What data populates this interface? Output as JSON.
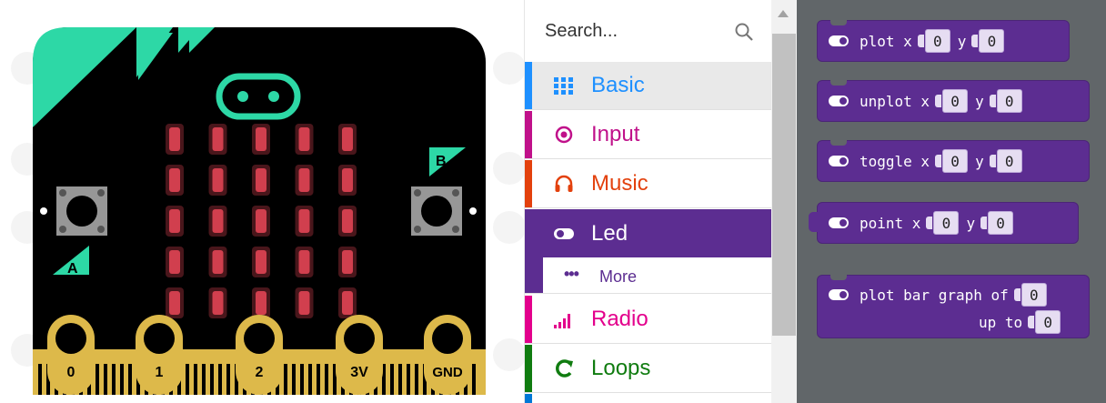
{
  "simulator": {
    "led_rows": 5,
    "led_cols": 5,
    "led_color": "#d13f4e",
    "board_color": "#000000",
    "accent_color": "#2dd8a6",
    "pin_color": "#ddb94a",
    "button_a_label": "A",
    "button_b_label": "B",
    "pins": [
      "0",
      "1",
      "2",
      "3V",
      "GND"
    ]
  },
  "toolbox": {
    "search_placeholder": "Search...",
    "categories": [
      {
        "label": "Basic",
        "color": "#1e90ff",
        "icon": "grid-icon"
      },
      {
        "label": "Input",
        "color": "#c0118a",
        "icon": "target-icon"
      },
      {
        "label": "Music",
        "color": "#e3410d",
        "icon": "headphones-icon"
      },
      {
        "label": "Led",
        "color": "#5c2d91",
        "icon": "toggle-icon",
        "selected": true
      },
      {
        "label": "More",
        "color": "#5c2d91",
        "icon": "dots-icon"
      },
      {
        "label": "Radio",
        "color": "#e3008c",
        "icon": "signal-bars-icon"
      },
      {
        "label": "Loops",
        "color": "#107c10",
        "icon": "loop-arrow-icon"
      }
    ]
  },
  "flyout": {
    "blocks": [
      {
        "keyword": "plot x",
        "x_value": "0",
        "y_label": "y",
        "y_value": "0"
      },
      {
        "keyword": "unplot x",
        "x_value": "0",
        "y_label": "y",
        "y_value": "0"
      },
      {
        "keyword": "toggle x",
        "x_value": "0",
        "y_label": "y",
        "y_value": "0"
      },
      {
        "keyword": "point x",
        "x_value": "0",
        "y_label": "y",
        "y_value": "0"
      }
    ],
    "bar_graph": {
      "label": "plot bar graph of",
      "value": "0",
      "up_to_label": "up to",
      "up_to_value": "0"
    }
  }
}
